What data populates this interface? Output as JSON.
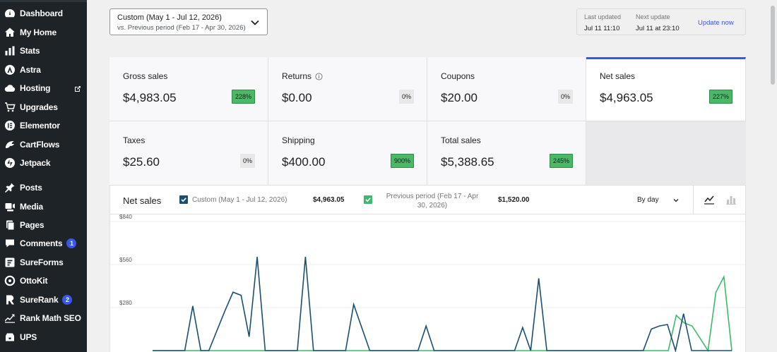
{
  "sidebar": {
    "items": [
      {
        "label": "Dashboard",
        "icon": "dashboard-icon"
      },
      {
        "label": "My Home",
        "icon": "home-icon"
      },
      {
        "label": "Stats",
        "icon": "stats-icon"
      },
      {
        "label": "Astra",
        "icon": "astra-icon"
      },
      {
        "label": "Hosting",
        "icon": "cloud-icon",
        "external": true
      },
      {
        "label": "Upgrades",
        "icon": "cart-icon"
      },
      {
        "label": "Elementor",
        "icon": "elementor-icon"
      },
      {
        "label": "CartFlows",
        "icon": "cartflows-icon"
      },
      {
        "label": "Jetpack",
        "icon": "jetpack-icon"
      },
      {
        "label": "Posts",
        "icon": "pin-icon"
      },
      {
        "label": "Media",
        "icon": "media-icon"
      },
      {
        "label": "Pages",
        "icon": "pages-icon"
      },
      {
        "label": "Comments",
        "icon": "comment-icon",
        "badge": "1"
      },
      {
        "label": "SureForms",
        "icon": "sureforms-icon"
      },
      {
        "label": "OttoKit",
        "icon": "ottokit-icon"
      },
      {
        "label": "SureRank",
        "icon": "surerank-icon",
        "badge": "2"
      },
      {
        "label": "Rank Math SEO",
        "icon": "rankmath-icon"
      },
      {
        "label": "UPS",
        "icon": "ups-icon"
      }
    ]
  },
  "date_range": {
    "label": "Custom (May 1 - Jul 12, 2026)",
    "compare": "vs. Previous period (Feb 17 - Apr 30, 2026)"
  },
  "update": {
    "last_label": "Last updated",
    "last_value": "Jul 11 11:10",
    "next_label": "Next update",
    "next_value": "Jul 11 at 23:10",
    "button": "Update now"
  },
  "summary": [
    {
      "label": "Gross sales",
      "value": "$4,983.05",
      "delta": "228%",
      "trend": "up"
    },
    {
      "label": "Returns",
      "value": "$0.00",
      "delta": "0%",
      "trend": "zero",
      "info": true
    },
    {
      "label": "Coupons",
      "value": "$20.00",
      "delta": "0%",
      "trend": "zero"
    },
    {
      "label": "Net sales",
      "value": "$4,963.05",
      "delta": "227%",
      "trend": "up",
      "active": true
    },
    {
      "label": "Taxes",
      "value": "$25.60",
      "delta": "0%",
      "trend": "zero"
    },
    {
      "label": "Shipping",
      "value": "$400.00",
      "delta": "900%",
      "trend": "up"
    },
    {
      "label": "Total sales",
      "value": "$5,388.65",
      "delta": "245%",
      "trend": "up"
    }
  ],
  "chart_panel": {
    "title": "Net sales",
    "current_label": "Custom (May 1 - Jul 12, 2026)",
    "current_total": "$4,963.05",
    "previous_label_1": "Previous period (Feb 17 - Apr",
    "previous_label_2": "30, 2026)",
    "previous_total": "$1,520.00",
    "interval": "By day"
  },
  "colors": {
    "accent": "#3858e9",
    "current_series": "#1c4e72",
    "previous_series": "#3cba6b",
    "delta_up": "#4ab866"
  },
  "chart_data": {
    "type": "line",
    "ylim": [
      0,
      840
    ],
    "yticks": [
      "$840",
      "$560",
      "$280"
    ],
    "ytick_values": [
      840,
      560,
      280
    ],
    "series": [
      {
        "name": "Custom (May 1 - Jul 12, 2026)",
        "values": [
          0,
          0,
          0,
          0,
          0,
          290,
          0,
          0,
          130,
          260,
          380,
          360,
          90,
          610,
          0,
          0,
          0,
          0,
          0,
          610,
          0,
          0,
          0,
          0,
          0,
          300,
          150,
          0,
          0,
          0,
          0,
          0,
          0,
          0,
          160,
          0,
          0,
          0,
          0,
          0,
          0,
          0,
          0,
          0,
          0,
          0,
          150,
          0,
          470,
          0,
          0,
          0,
          0,
          0,
          0,
          0,
          0,
          0,
          0,
          0,
          0,
          0,
          140,
          160,
          170,
          0,
          240,
          0,
          0,
          0,
          0,
          0,
          0
        ]
      },
      {
        "name": "Previous period (Feb 17 - Apr 30, 2026)",
        "values": [
          0,
          0,
          0,
          0,
          0,
          0,
          0,
          0,
          0,
          0,
          0,
          0,
          0,
          0,
          0,
          0,
          0,
          0,
          0,
          0,
          0,
          0,
          0,
          0,
          0,
          0,
          0,
          0,
          0,
          0,
          0,
          0,
          0,
          0,
          0,
          0,
          0,
          0,
          0,
          0,
          0,
          0,
          0,
          0,
          0,
          0,
          0,
          0,
          0,
          0,
          0,
          0,
          0,
          0,
          0,
          0,
          0,
          0,
          0,
          0,
          0,
          0,
          0,
          0,
          0,
          0,
          230,
          180,
          160,
          80,
          0,
          380,
          480,
          0
        ]
      }
    ]
  }
}
